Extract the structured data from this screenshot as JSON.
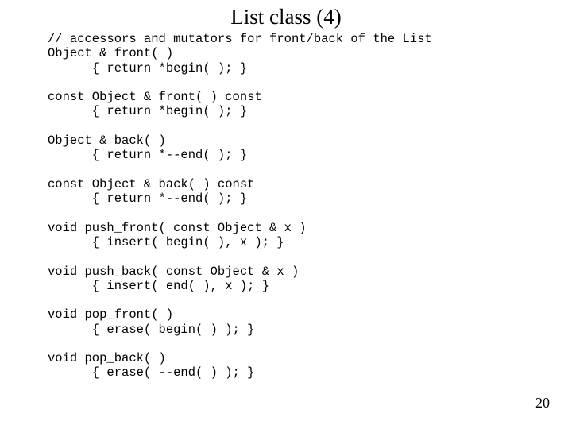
{
  "title": "List class (4)",
  "code": "// accessors and mutators for front/back of the List\nObject & front( )\n      { return *begin( ); }\n\nconst Object & front( ) const\n      { return *begin( ); }\n\nObject & back( )\n      { return *--end( ); }\n\nconst Object & back( ) const\n      { return *--end( ); }\n\nvoid push_front( const Object & x )\n      { insert( begin( ), x ); }\n\nvoid push_back( const Object & x )\n      { insert( end( ), x ); }\n\nvoid pop_front( )\n      { erase( begin( ) ); }\n\nvoid pop_back( )\n      { erase( --end( ) ); }",
  "page_number": "20"
}
